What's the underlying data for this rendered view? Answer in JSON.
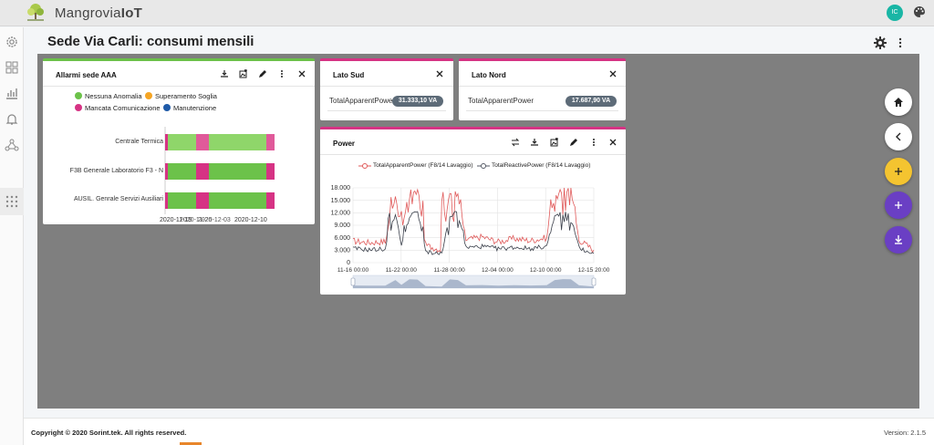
{
  "app": {
    "name_prefix": "Mangrovia",
    "name_suffix": "IoT",
    "user_initials": "IC",
    "logo_caption": "Mangrovia"
  },
  "page": {
    "title": "Sede Via Carli: consumi mensili"
  },
  "sidebar": {
    "items": [
      {
        "icon": "gear-icon"
      },
      {
        "icon": "dashboard-icon"
      },
      {
        "icon": "chart-icon"
      },
      {
        "icon": "bell-icon"
      },
      {
        "icon": "network-icon"
      },
      {
        "icon": "grid-icon"
      }
    ]
  },
  "widgets": {
    "alarms": {
      "title": "Allarmi sede AAA",
      "legend": [
        {
          "label": "Nessuna Anomalia",
          "color": "#6cc24a"
        },
        {
          "label": "Superamento Soglia",
          "color": "#f5a524"
        },
        {
          "label": "Mancata Comunicazione",
          "color": "#d63384"
        },
        {
          "label": "Manutenzione",
          "color": "#1e5aa8"
        }
      ],
      "rows": [
        "Centrale Termica",
        "F3B Generale Laboratorio F3 - N",
        "AUSIL. Genrale Servizi Ausiliari"
      ],
      "x_ticks": [
        "2020-11-26",
        "2020-12-03",
        "2020-12-10"
      ],
      "x_tick_overlap": [
        "2020-11-19",
        "2020-11-26",
        "2020-12-03"
      ]
    },
    "lato_sud": {
      "title": "Lato Sud",
      "label": "TotalApparentPower",
      "value": "31.333,10 VA"
    },
    "lato_nord": {
      "title": "Lato Nord",
      "label": "TotalApparentPower",
      "value": "17.687,90 VA"
    },
    "power": {
      "title": "Power"
    }
  },
  "chart_data": {
    "type": "line",
    "title": "Power",
    "series": [
      {
        "name": "TotalApparentPower (F8/14 Lavaggio)",
        "color": "#e05a5a"
      },
      {
        "name": "TotalReactivePower (F8/14 Lavaggio)",
        "color": "#555a66"
      }
    ],
    "x_ticks": [
      "11-16 00:00",
      "11-22 00:00",
      "11-28 00:00",
      "12-04 00:00",
      "12-10 00:00",
      "12-15 20:00"
    ],
    "y_ticks": [
      "0",
      "3.000",
      "6.000",
      "9.000",
      "12.000",
      "15.000",
      "18.000"
    ],
    "ylim": [
      0,
      18000
    ],
    "grid": true,
    "legend": "top",
    "approx_points": [
      {
        "x": "11-16 00:00",
        "apparent": 5200,
        "reactive": 3400
      },
      {
        "x": "11-18 00:00",
        "apparent": 4800,
        "reactive": 3100
      },
      {
        "x": "11-20 00:00",
        "apparent": 5100,
        "reactive": 3300
      },
      {
        "x": "11-21 06:00",
        "apparent": 16000,
        "reactive": 12000
      },
      {
        "x": "11-22 00:00",
        "apparent": 6500,
        "reactive": 4200
      },
      {
        "x": "11-23 00:00",
        "apparent": 17500,
        "reactive": 11000
      },
      {
        "x": "11-24 00:00",
        "apparent": 17000,
        "reactive": 12500
      },
      {
        "x": "11-25 00:00",
        "apparent": 4200,
        "reactive": 2600
      },
      {
        "x": "11-27 00:00",
        "apparent": 3000,
        "reactive": 2200
      },
      {
        "x": "11-28 00:00",
        "apparent": 17200,
        "reactive": 11500
      },
      {
        "x": "11-29 00:00",
        "apparent": 16000,
        "reactive": 12000
      },
      {
        "x": "11-30 00:00",
        "apparent": 5500,
        "reactive": 3600
      },
      {
        "x": "12-02 00:00",
        "apparent": 6200,
        "reactive": 3900
      },
      {
        "x": "12-04 00:00",
        "apparent": 5000,
        "reactive": 3300
      },
      {
        "x": "12-06 00:00",
        "apparent": 5800,
        "reactive": 3700
      },
      {
        "x": "12-08 00:00",
        "apparent": 5300,
        "reactive": 3400
      },
      {
        "x": "12-10 00:00",
        "apparent": 6000,
        "reactive": 3900
      },
      {
        "x": "12-11 00:00",
        "apparent": 16000,
        "reactive": 11000
      },
      {
        "x": "12-12 00:00",
        "apparent": 17800,
        "reactive": 12000
      },
      {
        "x": "12-13 00:00",
        "apparent": 17600,
        "reactive": 11500
      },
      {
        "x": "12-14 00:00",
        "apparent": 5500,
        "reactive": 3500
      },
      {
        "x": "12-15 20:00",
        "apparent": 3000,
        "reactive": 2200
      }
    ]
  },
  "fabs": [
    {
      "icon": "home-icon",
      "color": "#ffffff"
    },
    {
      "icon": "back-icon",
      "color": "#ffffff"
    },
    {
      "icon": "add-icon",
      "color": "#f4c430"
    },
    {
      "icon": "add-icon",
      "color": "#6a3fc4"
    },
    {
      "icon": "download-icon",
      "color": "#6a3fc4"
    }
  ],
  "footer": {
    "copyright": "Copyright © 2020 Sorint.tek. All rights reserved.",
    "version": "Version: 2.1.5"
  },
  "colors": {
    "accent_pink": "#d63384",
    "accent_green": "#6cc24a",
    "purple": "#6a3fc4",
    "yellow": "#f4c430"
  }
}
